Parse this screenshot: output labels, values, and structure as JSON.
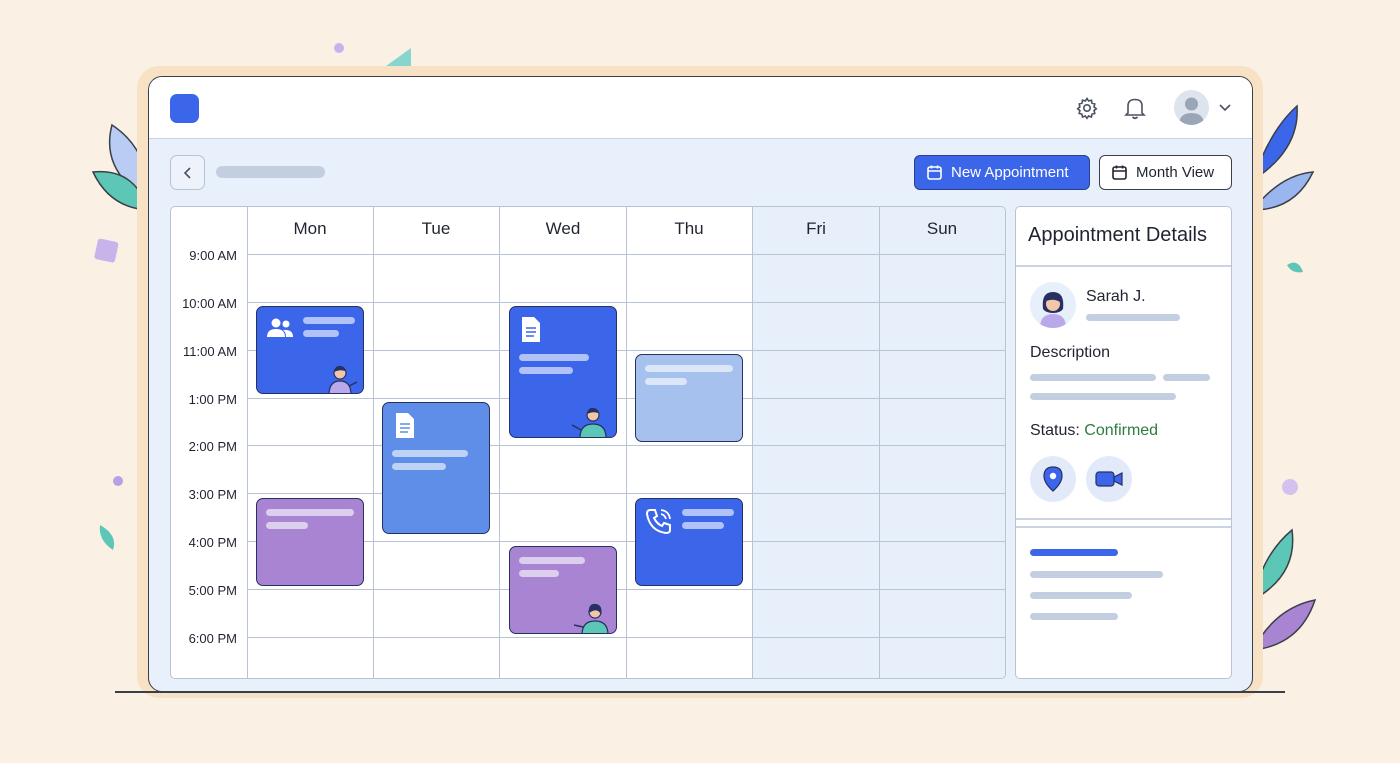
{
  "toolbar": {
    "new_appointment_label": "New Appointment",
    "month_view_label": "Month View"
  },
  "calendar": {
    "days": [
      "Mon",
      "Tue",
      "Wed",
      "Thu",
      "Fri",
      "Sun"
    ],
    "times": [
      "9:00 AM",
      "10:00 AM",
      "11:00 AM",
      "1:00 PM",
      "2:00 PM",
      "3:00 PM",
      "4:00 PM",
      "5:00 PM",
      "6:00 PM"
    ],
    "weekend_days": [
      "Fri",
      "Sun"
    ],
    "events": [
      {
        "day": "Mon",
        "start": "10:00 AM",
        "end": "1:00 PM",
        "color": "#3b66ea",
        "icon": "users-icon"
      },
      {
        "day": "Mon",
        "start": "3:00 PM",
        "end": "5:00 PM",
        "color": "#a884d3"
      },
      {
        "day": "Tue",
        "start": "1:00 PM",
        "end": "4:00 PM",
        "color": "#5e8ee8",
        "icon": "document-icon"
      },
      {
        "day": "Wed",
        "start": "10:00 AM",
        "end": "2:00 PM",
        "color": "#3b66ea",
        "icon": "document-icon"
      },
      {
        "day": "Wed",
        "start": "4:00 PM",
        "end": "6:00 PM",
        "color": "#a884d3"
      },
      {
        "day": "Thu",
        "start": "11:00 AM",
        "end": "2:00 PM",
        "color": "#a6c1ee"
      },
      {
        "day": "Thu",
        "start": "3:00 PM",
        "end": "5:00 PM",
        "color": "#3b66ea",
        "icon": "phone-icon"
      }
    ]
  },
  "details": {
    "title": "Appointment Details",
    "name": "Sarah J.",
    "description_label": "Description",
    "status_label": "Status:",
    "status_value": "Confirmed",
    "status_color": "#2d7d3f",
    "actions": [
      "location-pin-icon",
      "video-camera-icon"
    ]
  },
  "header": {
    "icons": [
      "settings-gear-icon",
      "notification-bell-icon",
      "user-avatar",
      "chevron-down-icon"
    ]
  },
  "colors": {
    "accent": "#3b66ea",
    "background": "#fbf0e4"
  }
}
